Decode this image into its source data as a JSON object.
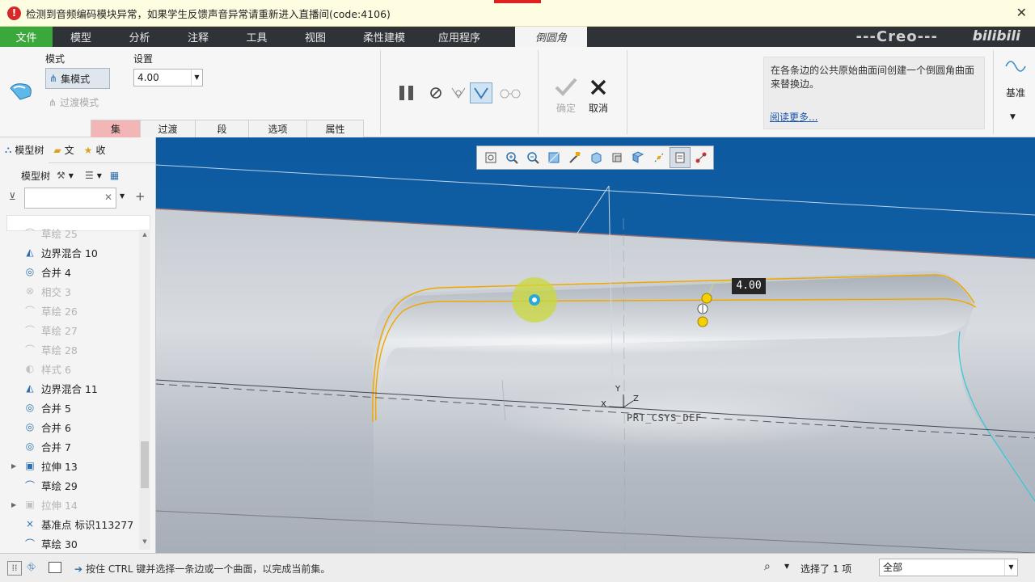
{
  "error_bar": {
    "message": "检测到音频编码模块异常，如果学生反馈声音异常请重新进入直播间(code:4106)",
    "close": "✕"
  },
  "menu": {
    "tabs": [
      "文件",
      "模型",
      "分析",
      "注释",
      "工具",
      "视图",
      "柔性建模",
      "应用程序",
      "倒圆角"
    ],
    "brand": "---Creo---",
    "watermark": "bilibili"
  },
  "ribbon": {
    "mode_label": "模式",
    "set_mode": "集模式",
    "transition_mode": "过渡模式",
    "settings_label": "设置",
    "radius_value": "4.00",
    "subtabs": [
      "集",
      "过渡",
      "段",
      "选项",
      "属性"
    ],
    "ok_label": "确定",
    "cancel_label": "取消",
    "info_text": "在各条边的公共原始曲面间创建一个倒圆角曲面来替换边。",
    "info_more": "阅读更多...",
    "datum_label": "基准"
  },
  "left_panel": {
    "tabs": [
      "模型树",
      "文",
      "收"
    ],
    "tree_label": "模型树",
    "nodes": [
      {
        "label": "草绘 25",
        "icon": "sketch-icon",
        "dim": true
      },
      {
        "label": "边界混合 10",
        "icon": "boundary-blend-icon",
        "dim": false
      },
      {
        "label": "合并 4",
        "icon": "merge-icon",
        "dim": false
      },
      {
        "label": "相交 3",
        "icon": "intersect-icon",
        "dim": true
      },
      {
        "label": "草绘 26",
        "icon": "sketch-icon",
        "dim": true
      },
      {
        "label": "草绘 27",
        "icon": "sketch-icon",
        "dim": true
      },
      {
        "label": "草绘 28",
        "icon": "sketch-icon",
        "dim": true
      },
      {
        "label": "样式 6",
        "icon": "style-icon",
        "dim": true
      },
      {
        "label": "边界混合 11",
        "icon": "boundary-blend-icon",
        "dim": false
      },
      {
        "label": "合并 5",
        "icon": "merge-icon",
        "dim": false
      },
      {
        "label": "合并 6",
        "icon": "merge-icon",
        "dim": false
      },
      {
        "label": "合并 7",
        "icon": "merge-icon",
        "dim": false
      },
      {
        "label": "拉伸 13",
        "icon": "extrude-icon",
        "dim": false,
        "expandable": true
      },
      {
        "label": "草绘 29",
        "icon": "sketch-icon",
        "dim": false
      },
      {
        "label": "拉伸 14",
        "icon": "extrude-icon",
        "dim": true,
        "expandable": true
      },
      {
        "label": "基准点 标识113277",
        "icon": "datum-point-icon",
        "dim": false
      },
      {
        "label": "草绘 30",
        "icon": "sketch-icon",
        "dim": false
      }
    ]
  },
  "viewport": {
    "dimension_tag": "4.00",
    "csys_label": "PRT_CSYS_DEF",
    "axis_x": "X",
    "axis_y": "Y",
    "axis_z": "Z"
  },
  "status": {
    "message": "按住 CTRL 键并选择一条边或一个曲面，以完成当前集。",
    "selected": "选择了 1 项",
    "filter": "全部"
  },
  "colors": {
    "file_tab": "#3aa83a",
    "menubar": "#2f3338",
    "active_subtab": "#f3b6b6",
    "viewport_top": "#0f62a8",
    "highlight": "#f0a800"
  }
}
